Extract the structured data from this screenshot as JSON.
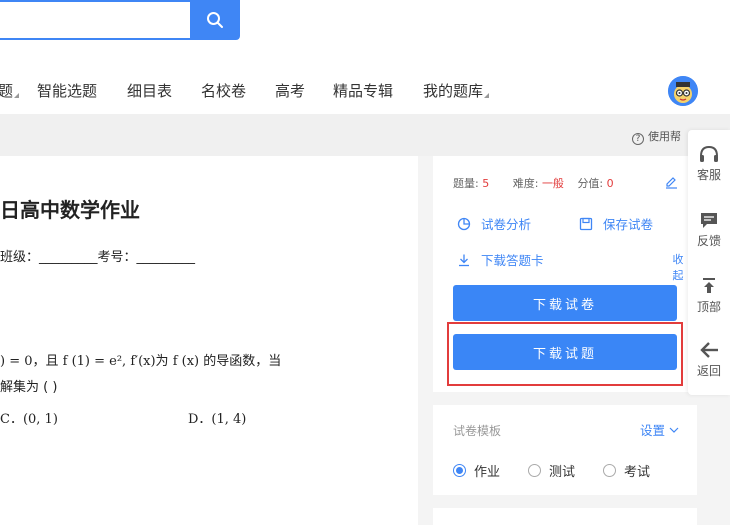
{
  "nav": {
    "items": [
      "题",
      "智能选题",
      "细目表",
      "名校卷",
      "高考",
      "精品专辑",
      "我的题库"
    ]
  },
  "help": {
    "label": "使用帮"
  },
  "paper": {
    "title": "日高中数学作业",
    "info": "班级：_________考号：_________",
    "question": {
      "line1": ") = 0，且 f (1) = e², f′(x)为 f (x) 的导函数，当",
      "line2": "解集为 (        )",
      "option_c": "C．(0, 1)",
      "option_d": "D．(1, 4)"
    }
  },
  "panel": {
    "stats": {
      "count_label": "题量:",
      "count_value": "5",
      "difficulty_label": "难度:",
      "difficulty_value": "一般",
      "score_label": "分值:",
      "score_value": "0"
    },
    "actions": {
      "analysis": "试卷分析",
      "save": "保存试卷",
      "download_card": "下载答题卡"
    },
    "collapse": "收起",
    "buttons": {
      "download_paper": "下载试卷",
      "download_questions": "下载试题"
    }
  },
  "template": {
    "label": "试卷模板",
    "settings": "设置",
    "options": [
      "作业",
      "测试",
      "考试"
    ],
    "selected": "作业"
  },
  "float_sidebar": {
    "service": "客服",
    "feedback": "反馈",
    "top": "顶部",
    "back": "返回"
  },
  "colors": {
    "primary": "#3f86f5",
    "danger": "#e23c3c"
  }
}
